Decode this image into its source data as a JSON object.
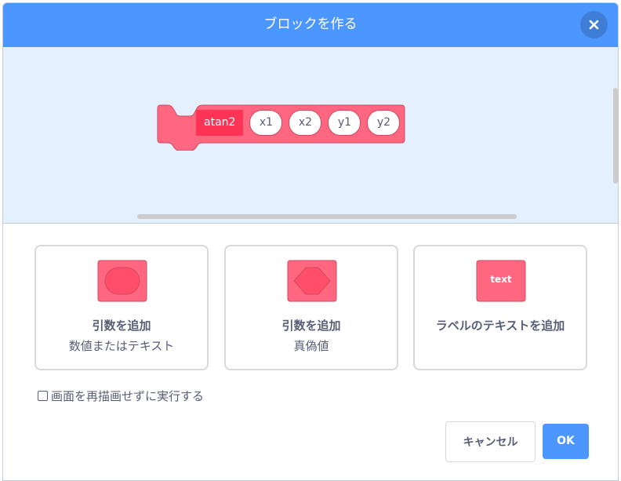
{
  "dialog": {
    "title": "ブロックを作る",
    "close_icon": "close-x-icon"
  },
  "block": {
    "label": "atan2",
    "args": [
      "x1",
      "x2",
      "y1",
      "y2"
    ],
    "color": "#ff6680",
    "label_color": "#ff3355"
  },
  "options": [
    {
      "title": "引数を追加",
      "subtitle": "数値またはテキスト",
      "icon": "round-input-icon"
    },
    {
      "title": "引数を追加",
      "subtitle": "真偽値",
      "icon": "boolean-input-icon"
    },
    {
      "title": "ラベルのテキストを追加",
      "icon": "label-text-icon",
      "icon_text": "text"
    }
  ],
  "checkbox": {
    "label": "画面を再描画せずに実行する",
    "checked": false
  },
  "buttons": {
    "cancel": "キャンセル",
    "ok": "OK"
  },
  "colors": {
    "accent": "#4c97ff",
    "workspace": "#e5f0ff",
    "block": "#ff6680"
  }
}
